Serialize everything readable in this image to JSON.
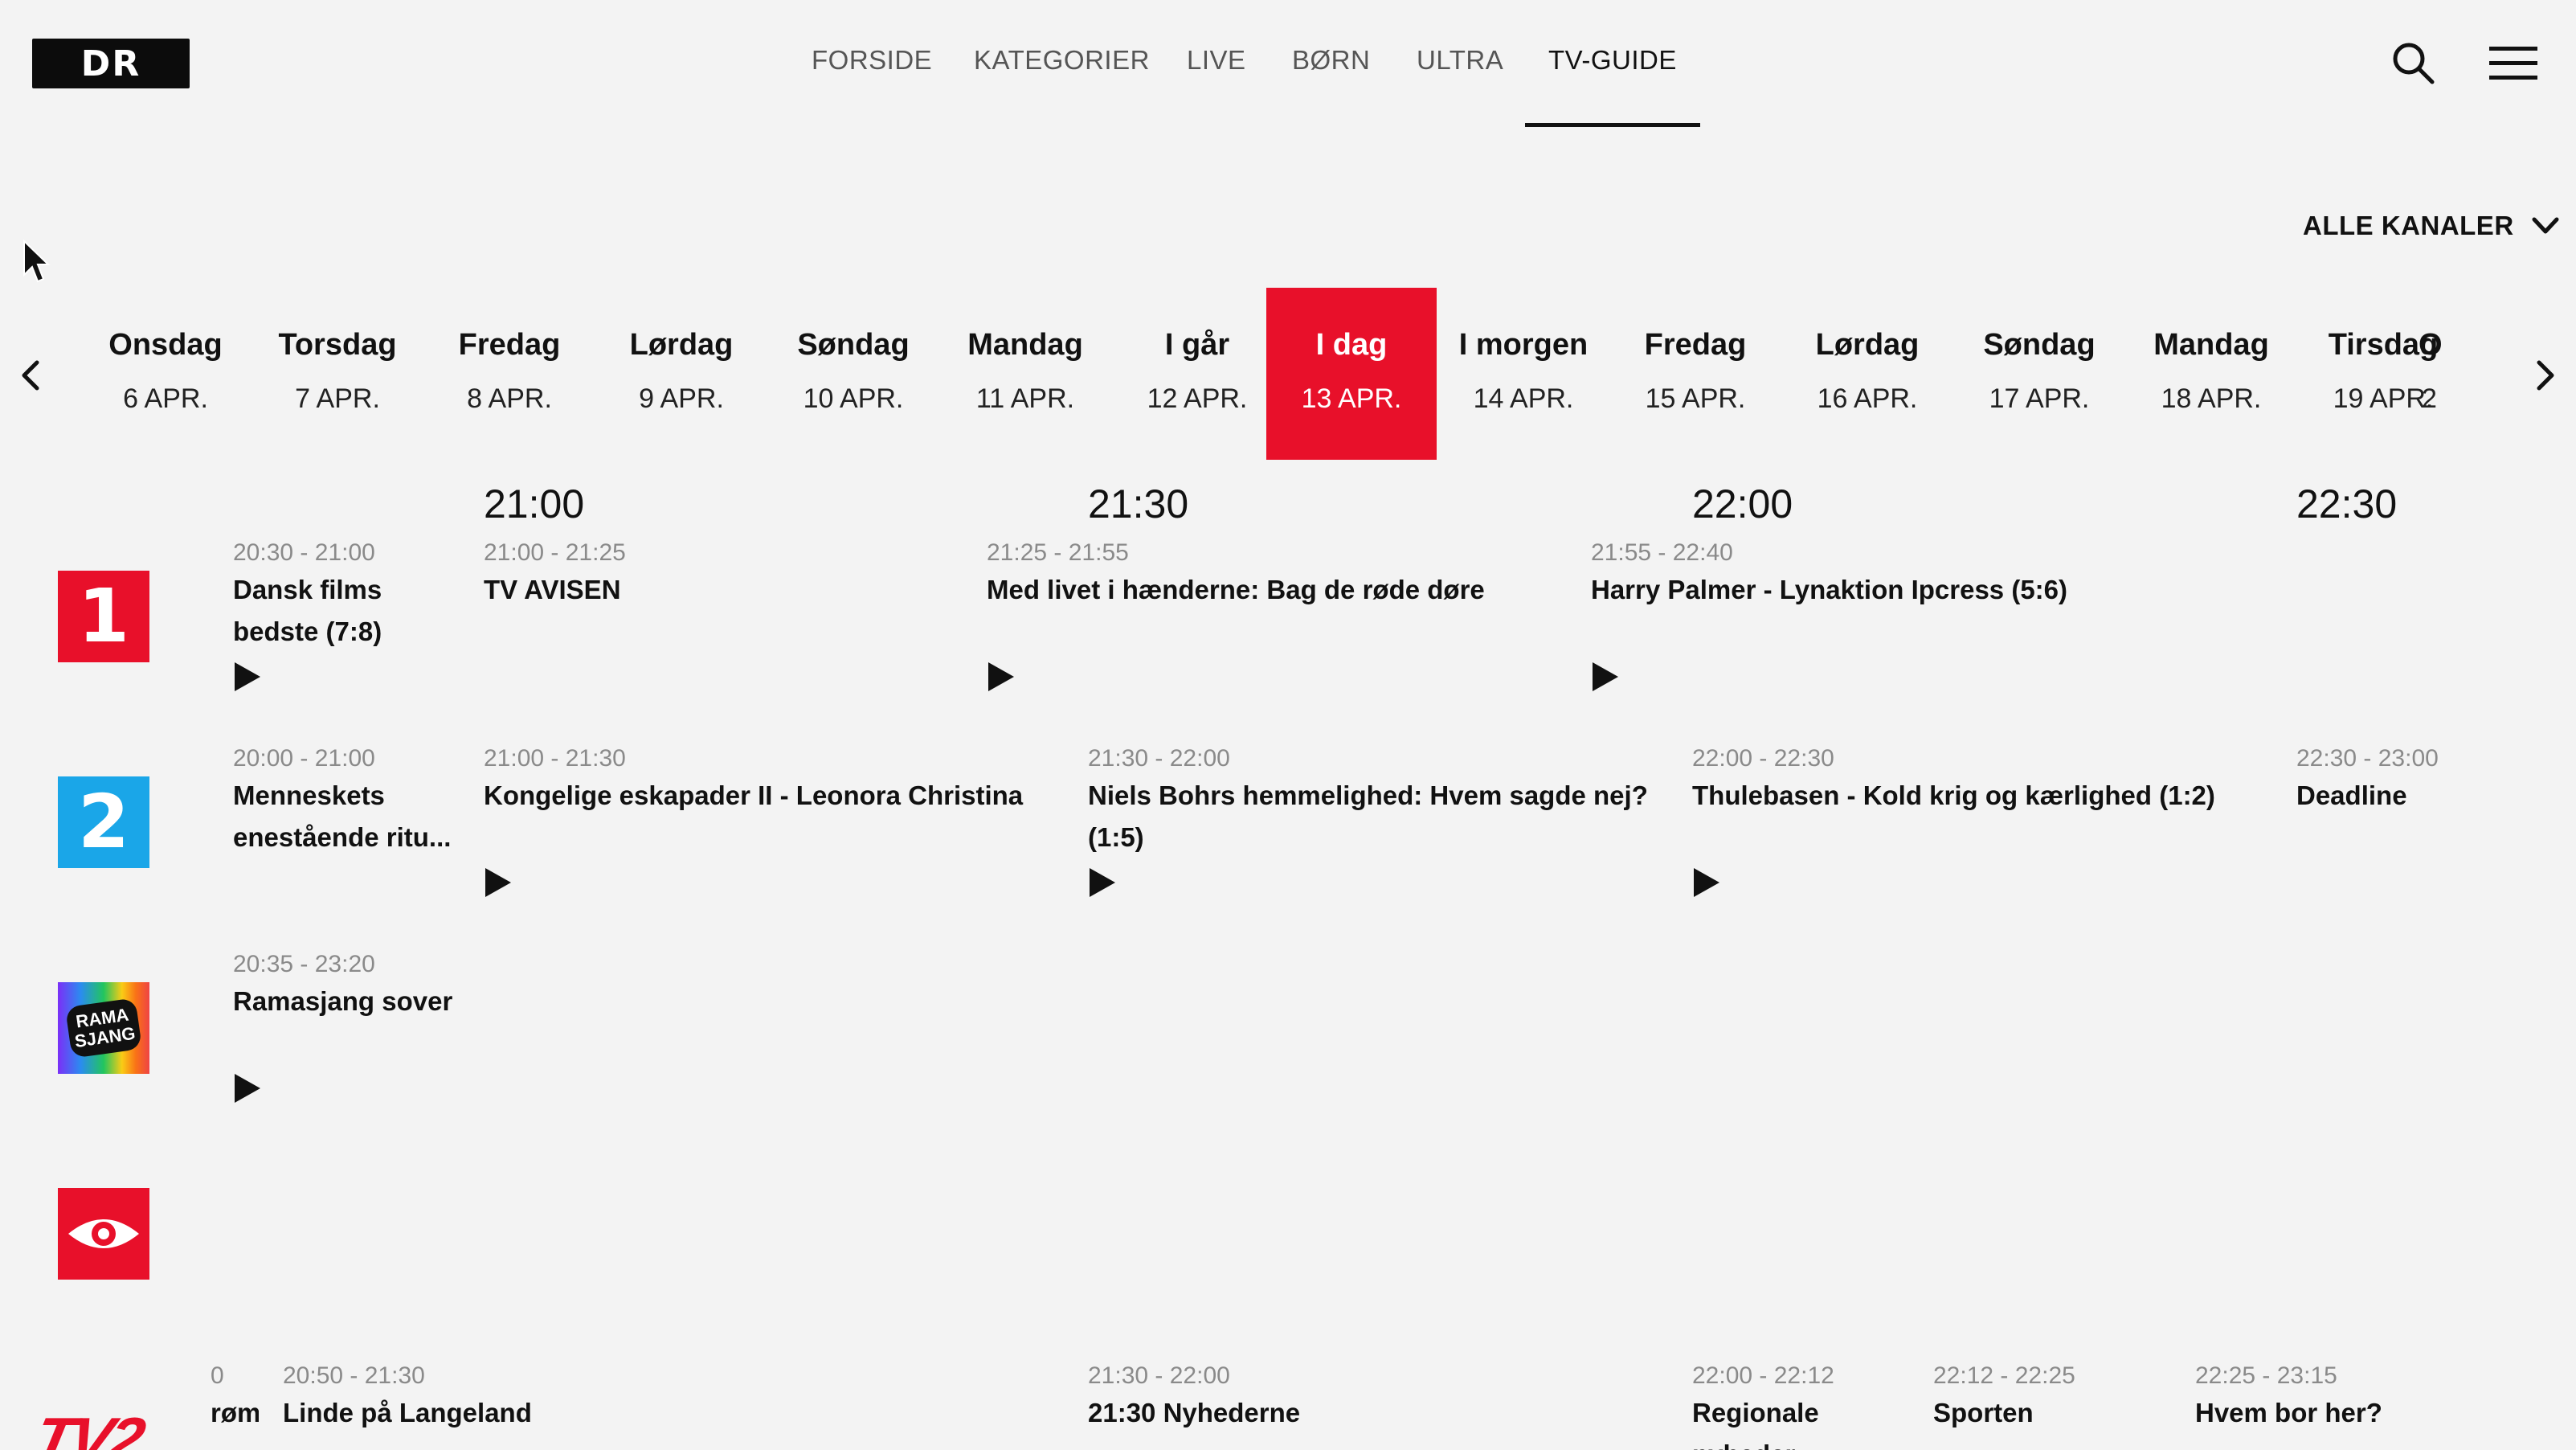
{
  "header": {
    "logo_text": "DR",
    "nav": [
      "FORSIDE",
      "KATEGORIER",
      "LIVE",
      "BØRN",
      "ULTRA",
      "TV-GUIDE"
    ],
    "active_nav": "TV-GUIDE"
  },
  "filter": {
    "label": "ALLE KANALER"
  },
  "days": [
    {
      "name": "Onsdag",
      "date": "6 APR."
    },
    {
      "name": "Torsdag",
      "date": "7 APR."
    },
    {
      "name": "Fredag",
      "date": "8 APR."
    },
    {
      "name": "Lørdag",
      "date": "9 APR."
    },
    {
      "name": "Søndag",
      "date": "10 APR."
    },
    {
      "name": "Mandag",
      "date": "11 APR."
    },
    {
      "name": "I går",
      "date": "12 APR."
    },
    {
      "name": "I dag",
      "date": "13 APR."
    },
    {
      "name": "I morgen",
      "date": "14 APR."
    },
    {
      "name": "Fredag",
      "date": "15 APR."
    },
    {
      "name": "Lørdag",
      "date": "16 APR."
    },
    {
      "name": "Søndag",
      "date": "17 APR."
    },
    {
      "name": "Mandag",
      "date": "18 APR."
    },
    {
      "name": "Tirsdag",
      "date": "19 APR."
    },
    {
      "name": "O",
      "date": "2"
    }
  ],
  "selected_day": "I dag",
  "timeline": [
    "21:00",
    "21:30",
    "22:00",
    "22:30"
  ],
  "channels": [
    {
      "logo": "dr1-logo",
      "logo_text": "1",
      "programs": [
        {
          "time": "20:30 - 21:00",
          "title": "Dansk films bedste (7:8)",
          "play": true
        },
        {
          "time": "21:00 - 21:25",
          "title": "TV AVISEN",
          "play": false
        },
        {
          "time": "21:25 - 21:55",
          "title": "Med livet i hænderne: Bag de røde døre",
          "play": true
        },
        {
          "time": "21:55 - 22:40",
          "title": "Harry Palmer - Lynaktion Ipcress (5:6)",
          "play": true
        }
      ]
    },
    {
      "logo": "dr2-logo",
      "logo_text": "2",
      "programs": [
        {
          "time": "20:00 - 21:00",
          "title": "Menneskets enestående ritu...",
          "play": false
        },
        {
          "time": "21:00 - 21:30",
          "title": "Kongelige eskapader II - Leonora Christina",
          "play": true
        },
        {
          "time": "21:30 - 22:00",
          "title": "Niels Bohrs hemmelighed: Hvem sagde nej? (1:5)",
          "play": true
        },
        {
          "time": "22:00 - 22:30",
          "title": "Thulebasen - Kold krig og kærlighed (1:2)",
          "play": true
        },
        {
          "time": "22:30 - 23:00",
          "title": "Deadline",
          "play": false
        }
      ]
    },
    {
      "logo": "ramasjang-logo",
      "logo_text": "RAMA SJANG",
      "programs": [
        {
          "time": "20:35 - 23:20",
          "title": "Ramasjang sover",
          "play": true
        }
      ]
    },
    {
      "logo": "eye-channel-logo",
      "programs": []
    },
    {
      "logo": "tv2-logo",
      "logo_text": "TV2",
      "programs": [
        {
          "time": "0",
          "title": "røm",
          "play": false
        },
        {
          "time": "20:50 - 21:30",
          "title": "Linde på Langeland",
          "play": false
        },
        {
          "time": "21:30 - 22:00",
          "title": "21:30 Nyhederne",
          "play": false
        },
        {
          "time": "22:00 - 22:12",
          "title": "Regionale nyheder",
          "play": false
        },
        {
          "time": "22:12 - 22:25",
          "title": "Sporten",
          "play": false
        },
        {
          "time": "22:25 - 23:15",
          "title": "Hvem bor her?",
          "play": false
        }
      ]
    }
  ],
  "colors": {
    "accent": "#e8102a",
    "dr2": "#1aa6e8",
    "background": "#f3f3f3"
  }
}
